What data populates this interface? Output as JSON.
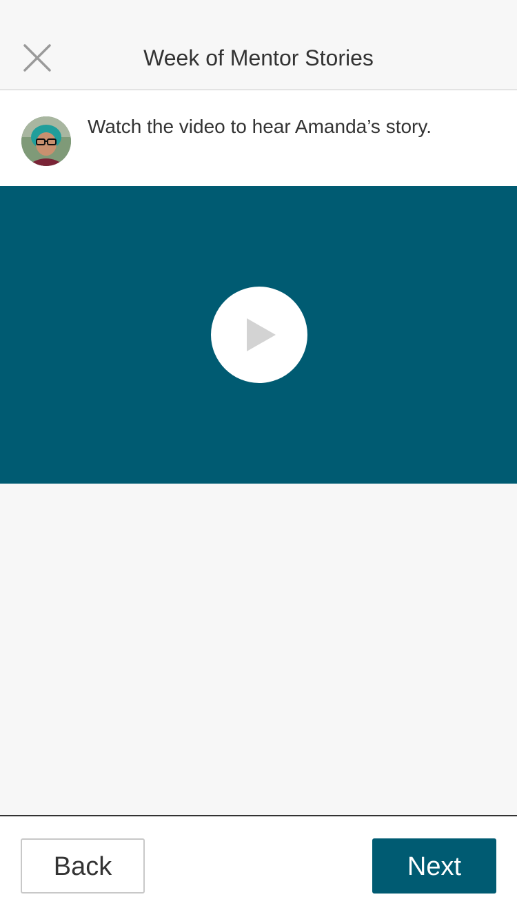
{
  "header": {
    "title": "Week of Mentor Stories",
    "close_icon": "close-icon"
  },
  "intro": {
    "text": "Watch the video to hear Amanda’s story.",
    "avatar_icon": "avatar"
  },
  "video": {
    "background_color": "#005b72",
    "play_icon": "play-icon"
  },
  "footer": {
    "back_label": "Back",
    "next_label": "Next"
  },
  "colors": {
    "accent": "#005b72",
    "background": "#f7f7f7",
    "text": "#333333"
  }
}
